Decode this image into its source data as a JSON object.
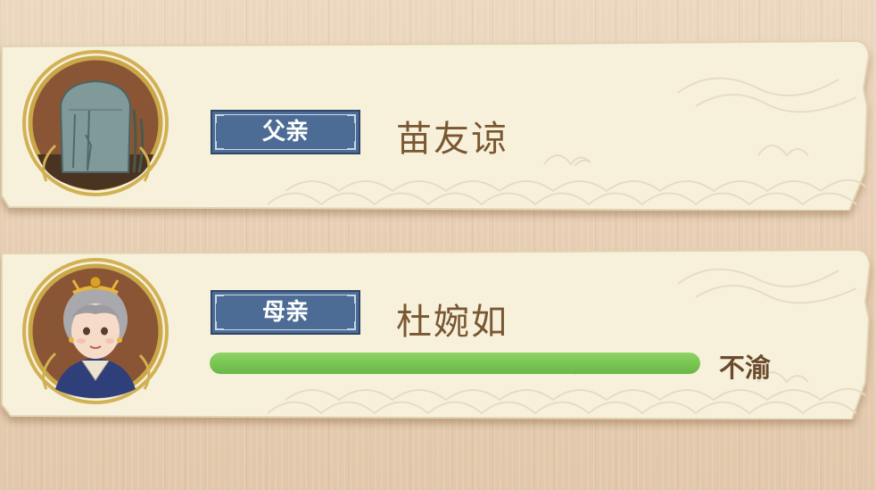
{
  "family_members": [
    {
      "relation": "父亲",
      "name": "苗友谅",
      "portrait_icon": "tombstone-icon"
    },
    {
      "relation": "母亲",
      "name": "杜婉如",
      "portrait_icon": "mother-portrait-icon",
      "mood": {
        "label": "不渝",
        "level_percent": 100,
        "bar_color": "#77c451"
      }
    }
  ],
  "colors": {
    "tag_background": "#4c6c95",
    "name_text": "#7a5732",
    "mood_text": "#6b4a2d",
    "frame_gold": "#c9a646",
    "portrait_brown": "#8a5535"
  }
}
